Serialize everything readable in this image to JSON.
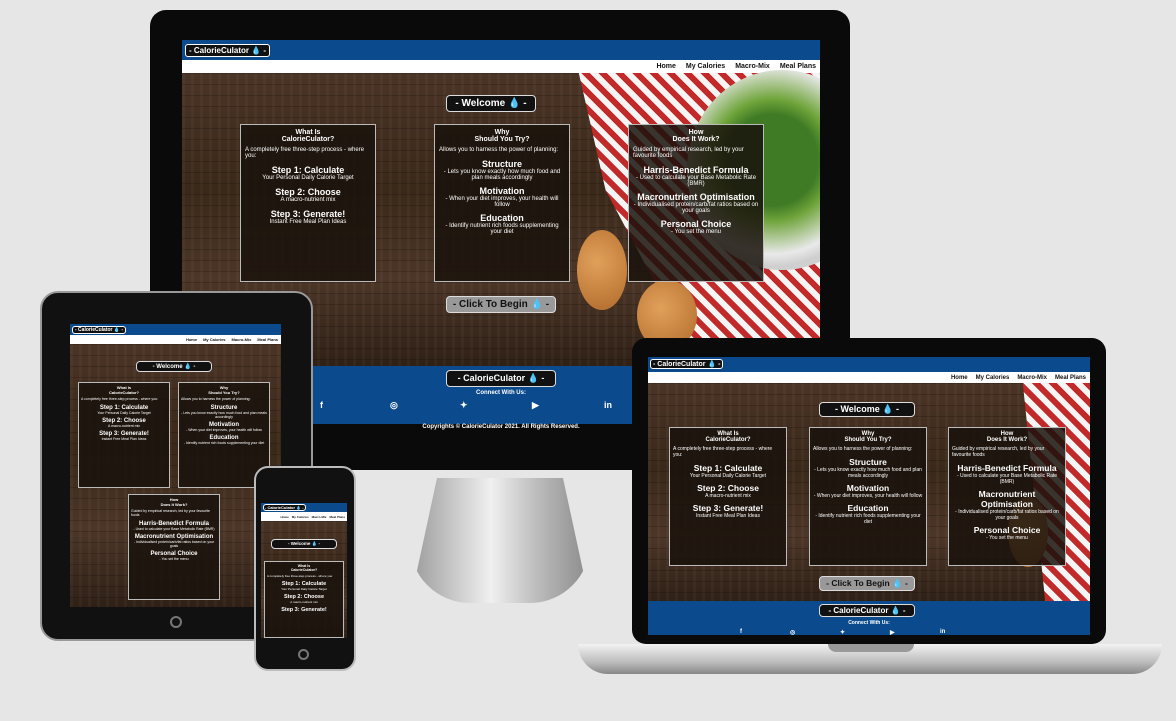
{
  "site": {
    "logo": "- CalorieCulator 💧 -",
    "nav": [
      "Home",
      "My Calories",
      "Macro-Mix",
      "Meal Plans"
    ],
    "welcome": "- Welcome 💧 -",
    "cta": "- Click To Begin 💧 -",
    "cards": [
      {
        "h1": "What Is",
        "h2": "CalorieCulator?",
        "intro": "A completely free three-step process - where you:",
        "items": [
          {
            "title": "Step 1: Calculate",
            "desc": "Your Personal Daily Calorie Target"
          },
          {
            "title": "Step 2: Choose",
            "desc": "A macro-nutrient mix"
          },
          {
            "title": "Step 3: Generate!",
            "desc": "Instant Free Meal Plan Ideas"
          }
        ]
      },
      {
        "h1": "Why",
        "h2": "Should You Try?",
        "intro": "Allows you to harness the power of planning:",
        "items": [
          {
            "title": "Structure",
            "desc": "- Lets you know exactly how much food and plan meals accordingly"
          },
          {
            "title": "Motivation",
            "desc": "- When your diet improves, your health will follow"
          },
          {
            "title": "Education",
            "desc": "- Identify nutrient rich foods supplementing your diet"
          }
        ]
      },
      {
        "h1": "How",
        "h2": "Does It Work?",
        "intro": "Guided by empirical research, led by your favourite foods",
        "items": [
          {
            "title": "Harris-Benedict Formula",
            "desc": "- Used to calculate your Base Metabolic Rate (BMR)"
          },
          {
            "title": "Macronutrient Optimisation",
            "desc": "- Individualised protein/carb/fat ratios based on your goals"
          },
          {
            "title": "Personal Choice",
            "desc": "- You set the menu"
          }
        ]
      }
    ],
    "footer": {
      "logo": "- CalorieCulator 💧 -",
      "connect": "Connect With Us:",
      "social_icons": [
        "facebook-icon",
        "instagram-icon",
        "twitter-icon",
        "youtube-icon",
        "linkedin-icon"
      ],
      "copyright": "Copyrights © CalorieCulator 2021. All Rights Reserved."
    }
  }
}
